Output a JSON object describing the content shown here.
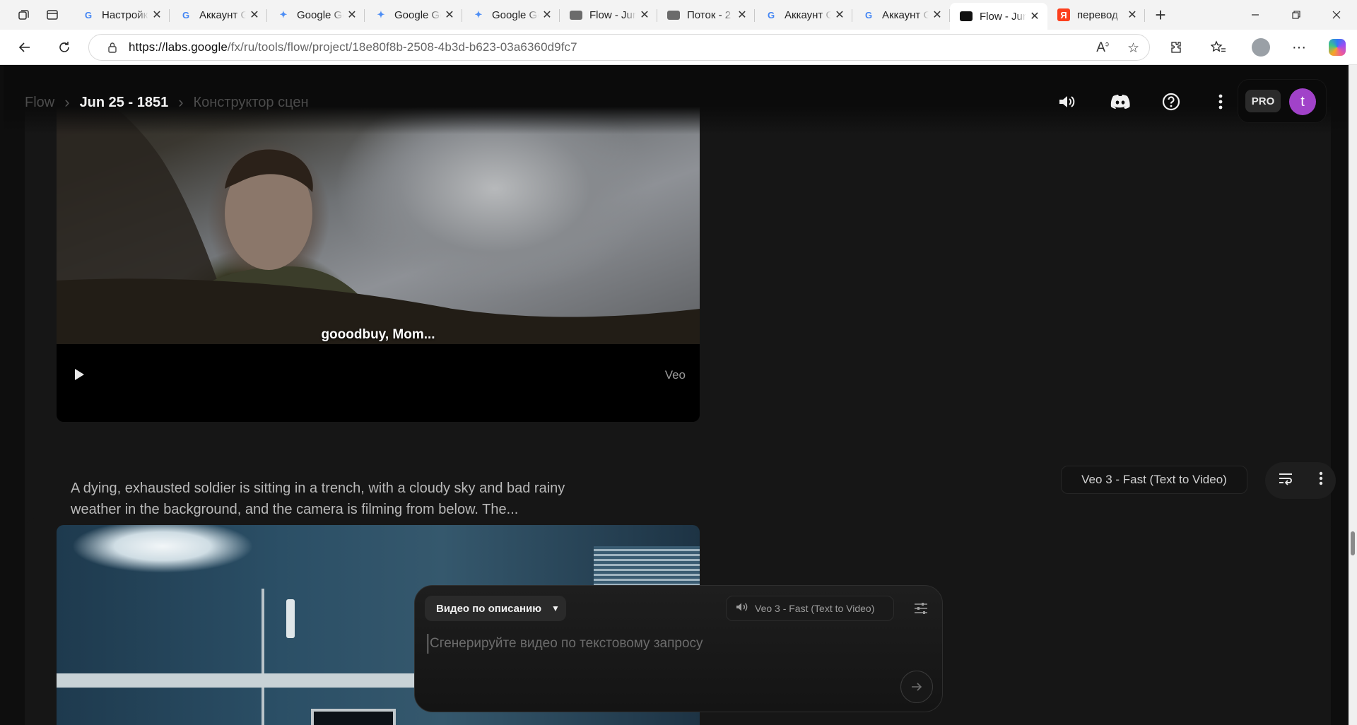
{
  "browser": {
    "tabs": [
      {
        "label": "Настройк",
        "favicon": "google-g-icon"
      },
      {
        "label": "Аккаунт G",
        "favicon": "google-g-icon"
      },
      {
        "label": "Google Ge",
        "favicon": "gemini-star-icon"
      },
      {
        "label": "Google Ge",
        "favicon": "gemini-star-icon"
      },
      {
        "label": "Google Ge",
        "favicon": "gemini-star-icon"
      },
      {
        "label": "Flow - Jun",
        "favicon": "folder-icon"
      },
      {
        "label": "Поток - 2",
        "favicon": "folder-icon"
      },
      {
        "label": "Аккаунт G",
        "favicon": "google-g-icon"
      },
      {
        "label": "Аккаунт G",
        "favicon": "google-g-icon"
      },
      {
        "label": "Flow - Jun",
        "favicon": "flow-icon",
        "active": true
      },
      {
        "label": "перевод",
        "favicon": "yandex-icon"
      }
    ],
    "url_host": "https://labs.google",
    "url_path": "/fx/ru/tools/flow/project/18e80f8b-2508-4b3d-b623-03a6360d9fc7"
  },
  "header": {
    "crumb_app": "Flow",
    "crumb_project": "Jun 25 - 1851",
    "crumb_page": "Конструктор сцен",
    "plan_badge": "PRO",
    "user_initial": "t"
  },
  "clip1": {
    "subtitle": "gooodbuy, Mom...",
    "watermark": "Veo",
    "prompt": "A dying, exhausted soldier is sitting in a trench, with a cloudy sky and bad rainy weather in the background, and the camera is filming from below. The...",
    "model": "Veo 3 - Fast (Text to Video)"
  },
  "composer": {
    "mode": "Видео по описанию",
    "model": "Veo 3 - Fast (Text to Video)",
    "placeholder": "Сгенерируйте видео по текстовому запросу"
  },
  "colors": {
    "page_bg": "#0e0e0e",
    "card_bg": "#161616",
    "avatar": "#a142c9"
  }
}
